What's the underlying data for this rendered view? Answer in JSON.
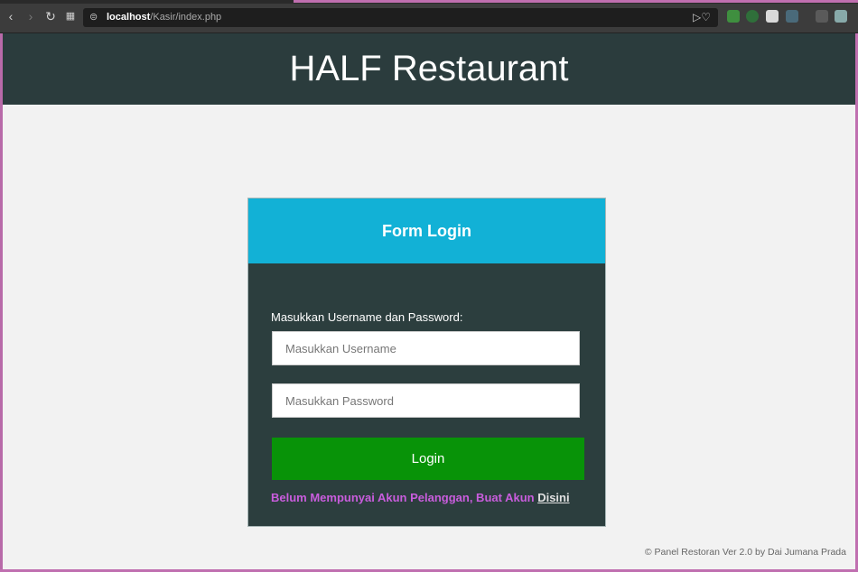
{
  "browser": {
    "url_host": "localhost",
    "url_path": "/Kasir/index.php"
  },
  "header": {
    "title": "HALF Restaurant"
  },
  "login": {
    "card_title": "Form Login",
    "prompt": "Masukkan Username dan Password:",
    "username_placeholder": "Masukkan Username",
    "password_placeholder": "Masukkan Password",
    "button_label": "Login",
    "register_text": "Belum Mempunyai Akun Pelanggan, Buat Akun ",
    "register_link": "Disini"
  },
  "footer": {
    "text": "© Panel Restoran Ver 2.0 by Dai Jumana Prada"
  },
  "colors": {
    "header_bg": "#2b3c3d",
    "card_head_bg": "#12b1d6",
    "button_bg": "#089308",
    "register_text": "#c95ddd"
  }
}
